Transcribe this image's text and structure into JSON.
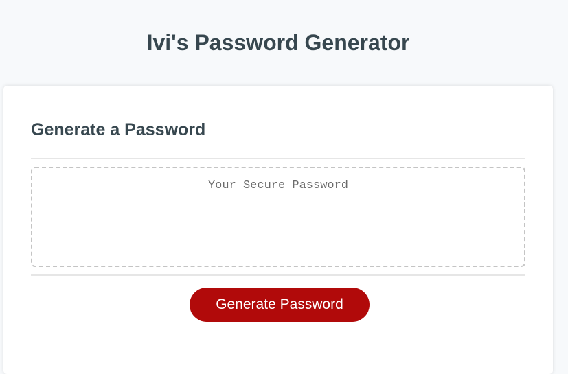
{
  "page": {
    "title": "Ivi's Password Generator"
  },
  "card": {
    "header": "Generate a Password",
    "password_field": {
      "value": "",
      "placeholder": "Your Secure Password"
    },
    "generate_button_label": "Generate Password"
  },
  "colors": {
    "background": "#f7f9fb",
    "heading": "#37474f",
    "button": "#b10a0a",
    "button_text": "#ffffff"
  }
}
